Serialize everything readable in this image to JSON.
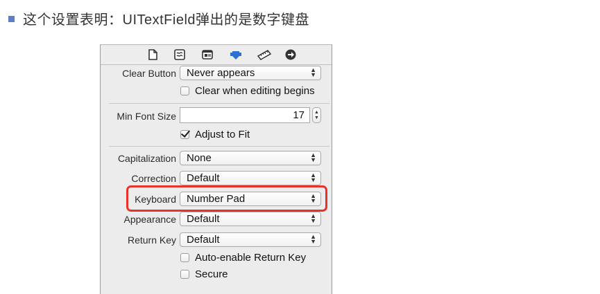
{
  "heading": {
    "text": "这个设置表明：UITextField弹出的是数字键盘"
  },
  "toolbar": {
    "icons": [
      "file-inspector-icon",
      "quick-help-icon",
      "identity-inspector-icon",
      "attributes-inspector-icon",
      "size-inspector-icon",
      "connections-inspector-icon"
    ],
    "active_color": "#2f6fd1"
  },
  "fields": {
    "clear_button": {
      "label": "Clear Button",
      "value": "Never appears"
    },
    "clear_when_editing": {
      "label": "Clear when editing begins",
      "checked": false
    },
    "min_font_size": {
      "label": "Min Font Size",
      "value": "17"
    },
    "adjust_to_fit": {
      "label": "Adjust to Fit",
      "checked": true
    },
    "capitalization": {
      "label": "Capitalization",
      "value": "None"
    },
    "correction": {
      "label": "Correction",
      "value": "Default"
    },
    "keyboard": {
      "label": "Keyboard",
      "value": "Number Pad"
    },
    "appearance": {
      "label": "Appearance",
      "value": "Default"
    },
    "return_key": {
      "label": "Return Key",
      "value": "Default"
    },
    "auto_enable_return_key": {
      "label": "Auto-enable Return Key",
      "checked": false
    },
    "secure": {
      "label": "Secure",
      "checked": false
    }
  },
  "highlight_color": "#e8322a"
}
